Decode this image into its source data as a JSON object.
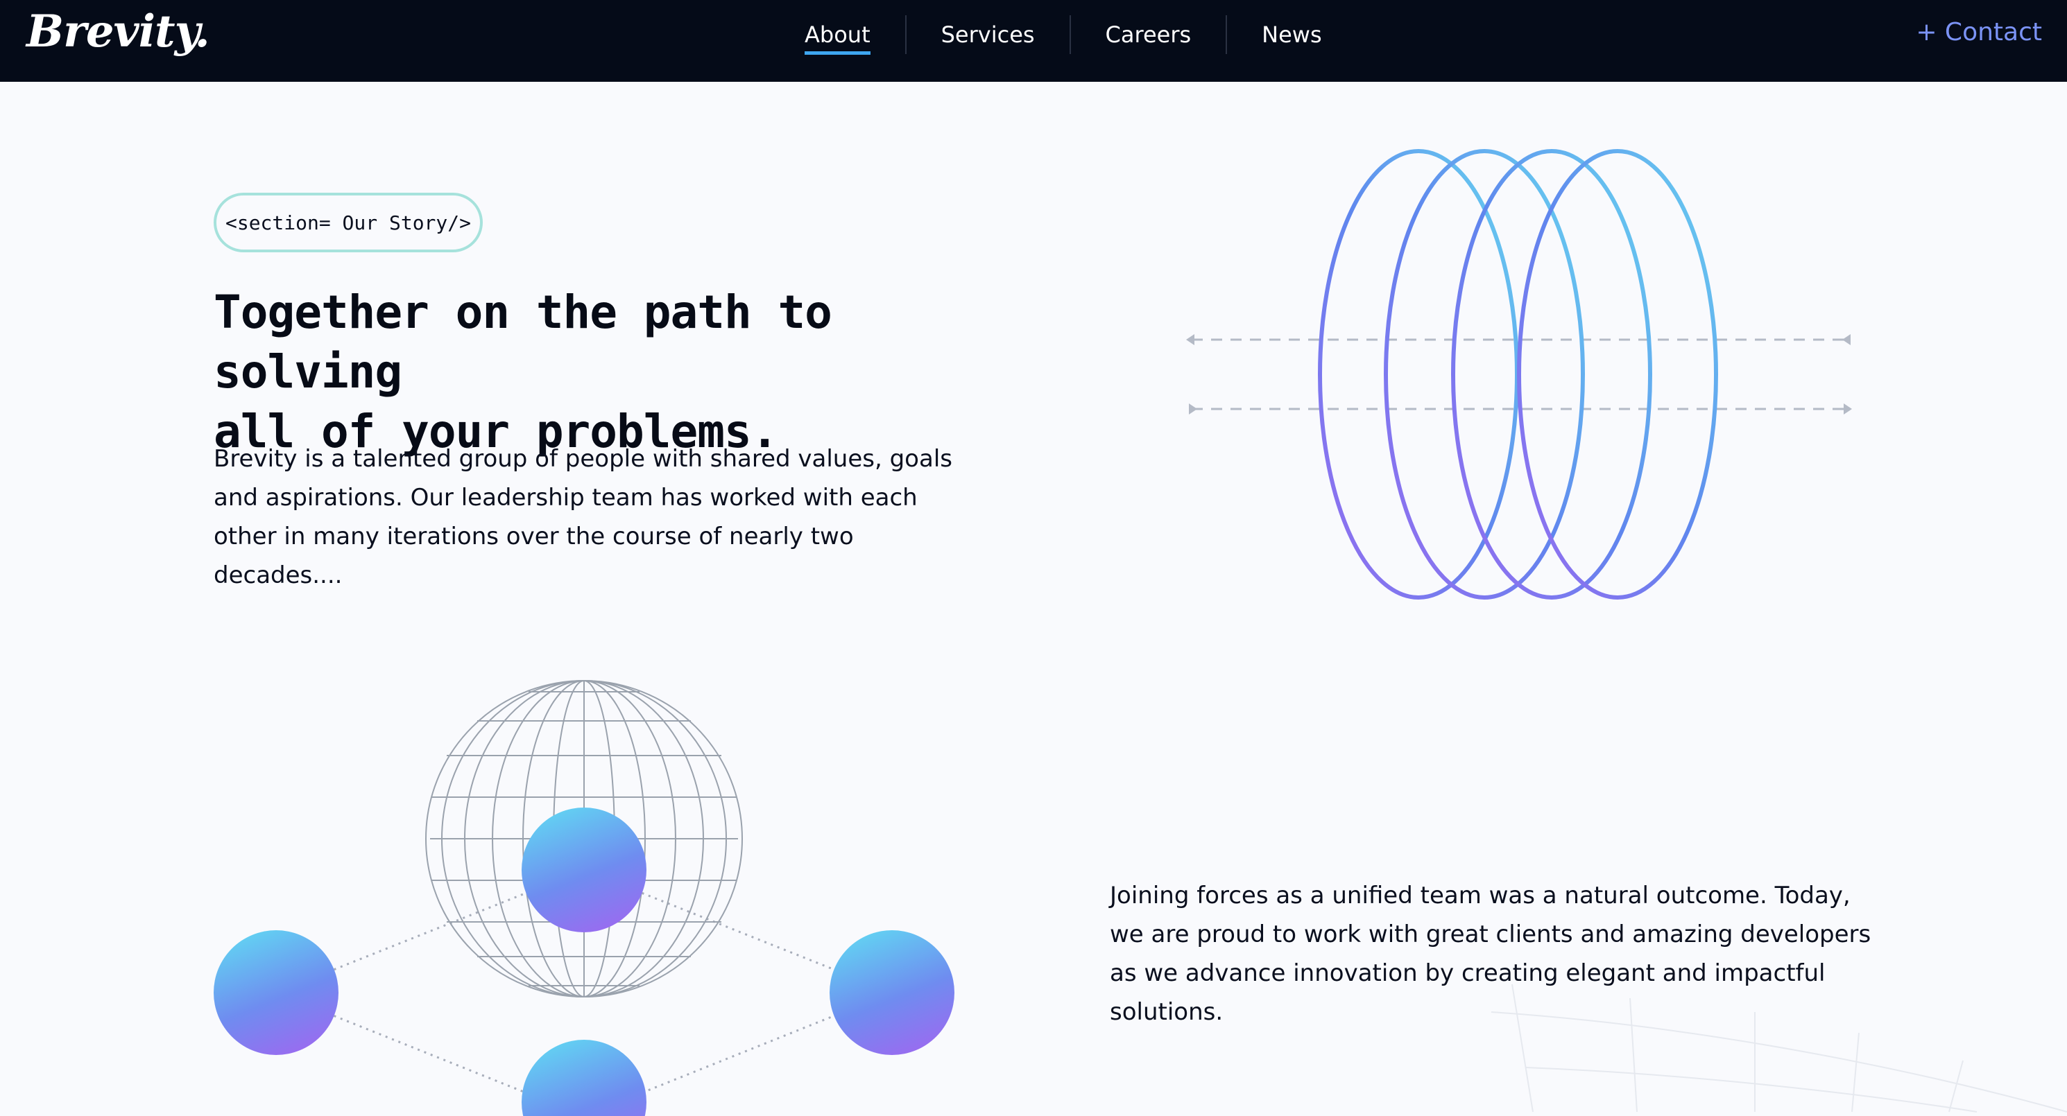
{
  "header": {
    "logo": "Brevity.",
    "nav": [
      {
        "label": "About",
        "active": true
      },
      {
        "label": "Services",
        "active": false
      },
      {
        "label": "Careers",
        "active": false
      },
      {
        "label": "News",
        "active": false
      }
    ],
    "contact_label": "+ Contact"
  },
  "hero": {
    "tag": "<section= Our Story/>",
    "headline_line1": "Together on the path to solving",
    "headline_line2": "all of your problems.",
    "paragraph": "Brevity is a talented group of people with shared values, goals and aspirations. Our leadership team has worked with each other in many iterations over the course of nearly two decades...."
  },
  "second": {
    "paragraph": "Joining forces as a unified team was a natural outcome. Today, we are proud to work with great clients and amazing developers as we advance innovation by creating elegant and impactful solutions."
  },
  "colors": {
    "nav_bg": "#050b18",
    "accent": "#3ea6f0",
    "contact": "#7b93f5",
    "gradient_start": "#5cd6f2",
    "gradient_end": "#9a6bf0"
  }
}
